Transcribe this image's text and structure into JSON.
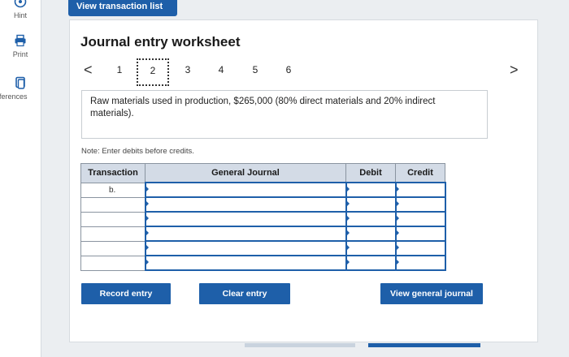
{
  "sidebar": {
    "items": [
      {
        "label": "Hint",
        "icon": "hint-icon"
      },
      {
        "label": "Print",
        "icon": "print-icon"
      },
      {
        "label": "eferences",
        "icon": "references-icon"
      }
    ]
  },
  "tab": {
    "label": "View transaction list"
  },
  "worksheet": {
    "title": "Journal entry worksheet",
    "pager": {
      "prev": "<",
      "next": ">",
      "pages": [
        "1",
        "2",
        "3",
        "4",
        "5",
        "6"
      ],
      "active_index": 1
    },
    "description": "Raw materials used in production, $265,000 (80% direct materials and 20% indirect materials).",
    "note": "Note: Enter debits before credits."
  },
  "journal": {
    "headers": {
      "transaction": "Transaction",
      "general_journal": "General Journal",
      "debit": "Debit",
      "credit": "Credit"
    },
    "rows": [
      {
        "transaction": "b.",
        "account": "",
        "debit": "",
        "credit": ""
      },
      {
        "transaction": "",
        "account": "",
        "debit": "",
        "credit": ""
      },
      {
        "transaction": "",
        "account": "",
        "debit": "",
        "credit": ""
      },
      {
        "transaction": "",
        "account": "",
        "debit": "",
        "credit": ""
      },
      {
        "transaction": "",
        "account": "",
        "debit": "",
        "credit": ""
      },
      {
        "transaction": "",
        "account": "",
        "debit": "",
        "credit": ""
      }
    ]
  },
  "buttons": {
    "record": "Record entry",
    "clear": "Clear entry",
    "view_journal": "View general journal"
  },
  "colors": {
    "accent": "#1e5fa9",
    "header_bg": "#d3dbe6",
    "panel_bg": "#ebeef1"
  }
}
